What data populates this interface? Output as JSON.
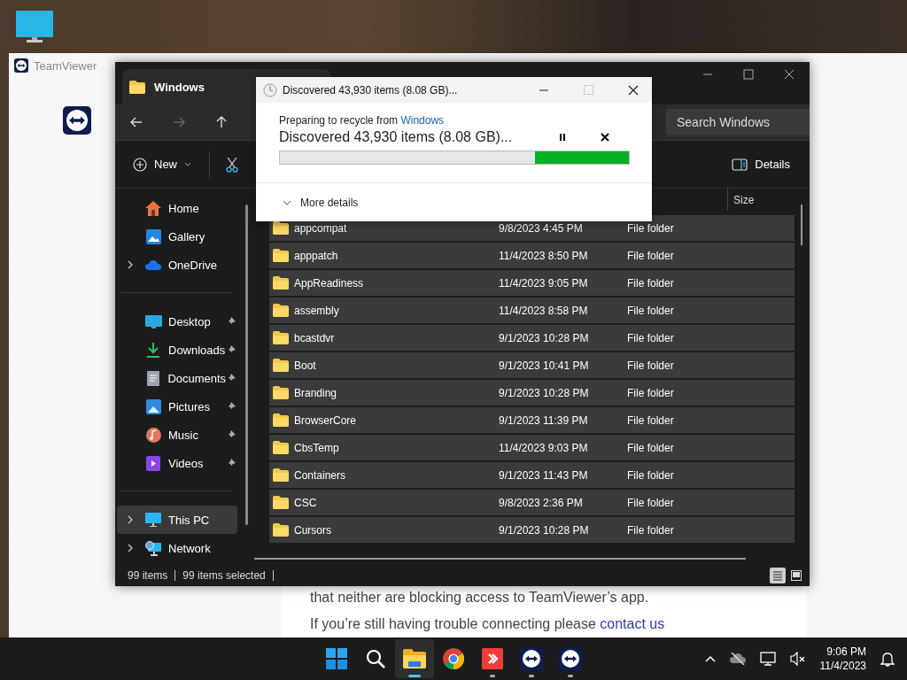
{
  "browser": {
    "title": "TeamViewer",
    "line": "that neither are blocking access to TeamViewer’s app.",
    "help_text": "If you’re still having trouble connecting please",
    "help_link": "contact us"
  },
  "explorer": {
    "tab": "Windows",
    "search_placeholder": "Search Windows",
    "new_label": "New",
    "details_label": "Details",
    "nav_sections": [
      [
        {
          "label": "Home",
          "kind": "home",
          "expandable": false,
          "pinned": false,
          "selected": false
        },
        {
          "label": "Gallery",
          "kind": "gallery",
          "expandable": false,
          "pinned": false,
          "selected": false
        },
        {
          "label": "OneDrive",
          "kind": "cloud",
          "expandable": true,
          "pinned": false,
          "selected": false
        }
      ],
      [
        {
          "label": "Desktop",
          "kind": "desktop",
          "expandable": false,
          "pinned": true,
          "selected": false
        },
        {
          "label": "Downloads",
          "kind": "downloads",
          "expandable": false,
          "pinned": true,
          "selected": false
        },
        {
          "label": "Documents",
          "kind": "documents",
          "expandable": false,
          "pinned": true,
          "selected": false
        },
        {
          "label": "Pictures",
          "kind": "pictures",
          "expandable": false,
          "pinned": true,
          "selected": false
        },
        {
          "label": "Music",
          "kind": "music",
          "expandable": false,
          "pinned": true,
          "selected": false
        },
        {
          "label": "Videos",
          "kind": "videos",
          "expandable": false,
          "pinned": true,
          "selected": false
        }
      ],
      [
        {
          "label": "This PC",
          "kind": "pc",
          "expandable": true,
          "pinned": false,
          "selected": true
        },
        {
          "label": "Network",
          "kind": "network",
          "expandable": true,
          "pinned": false,
          "selected": false
        }
      ]
    ],
    "columns": [
      "Size"
    ],
    "rows": [
      {
        "name": "appcompat",
        "date": "9/8/2023 4:45 PM",
        "type": "File folder",
        "selected": true
      },
      {
        "name": "apppatch",
        "date": "11/4/2023 8:50 PM",
        "type": "File folder",
        "selected": true
      },
      {
        "name": "AppReadiness",
        "date": "11/4/2023 9:05 PM",
        "type": "File folder",
        "selected": true
      },
      {
        "name": "assembly",
        "date": "11/4/2023 8:58 PM",
        "type": "File folder",
        "selected": true
      },
      {
        "name": "bcastdvr",
        "date": "9/1/2023 10:28 PM",
        "type": "File folder",
        "selected": true
      },
      {
        "name": "Boot",
        "date": "9/1/2023 10:41 PM",
        "type": "File folder",
        "selected": true
      },
      {
        "name": "Branding",
        "date": "9/1/2023 10:28 PM",
        "type": "File folder",
        "selected": true
      },
      {
        "name": "BrowserCore",
        "date": "9/1/2023 11:39 PM",
        "type": "File folder",
        "selected": true
      },
      {
        "name": "CbsTemp",
        "date": "11/4/2023 9:03 PM",
        "type": "File folder",
        "selected": true
      },
      {
        "name": "Containers",
        "date": "9/1/2023 11:43 PM",
        "type": "File folder",
        "selected": true
      },
      {
        "name": "CSC",
        "date": "9/8/2023 2:36 PM",
        "type": "File folder",
        "selected": true
      },
      {
        "name": "Cursors",
        "date": "9/1/2023 10:28 PM",
        "type": "File folder",
        "selected": true
      }
    ],
    "status": [
      "99 items",
      "99 items selected"
    ],
    "views": [
      {
        "kind": "details",
        "selected": true
      },
      {
        "kind": "preview",
        "selected": false
      }
    ]
  },
  "dialog": {
    "title": "Discovered 43,930 items (8.08 GB)...",
    "source_text": "Preparing to recycle from",
    "source_link": "Windows",
    "status": "Discovered 43,930 items (8.08 GB)...",
    "level": 0.27,
    "more": "More details"
  },
  "taskbar": {
    "apps": [
      {
        "kind": "start",
        "running": false,
        "active": false
      },
      {
        "kind": "search",
        "running": false,
        "active": false
      },
      {
        "kind": "explorer",
        "running": true,
        "active": true
      },
      {
        "kind": "chrome",
        "running": false,
        "active": false
      },
      {
        "kind": "remote",
        "running": true,
        "active": false
      },
      {
        "kind": "teamviewer",
        "running": true,
        "active": false
      },
      {
        "kind": "teamviewer",
        "running": true,
        "active": false
      }
    ],
    "time": "9:06 PM",
    "date": "11/4/2023"
  }
}
